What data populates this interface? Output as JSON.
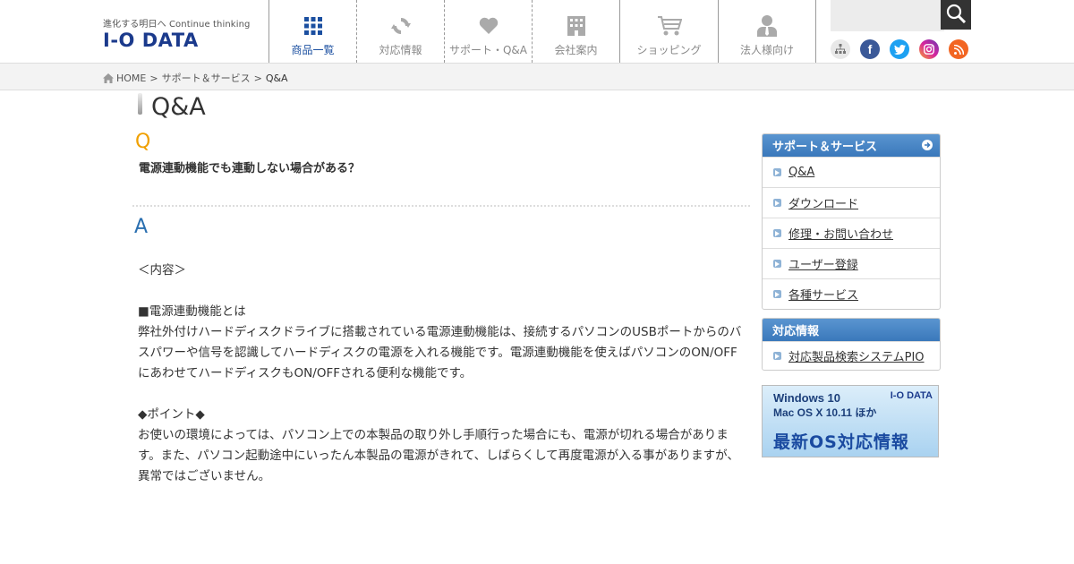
{
  "brand": {
    "tagline": "進化する明日へ Continue thinking",
    "name": "I-O DATA"
  },
  "nav": {
    "items": [
      {
        "label": "商品一覧",
        "icon": "grid-icon"
      },
      {
        "label": "対応情報",
        "icon": "refresh-icon"
      },
      {
        "label": "サポート・Q&A",
        "icon": "heart-icon"
      },
      {
        "label": "会社案内",
        "icon": "building-icon"
      },
      {
        "label": "ショッピング",
        "icon": "cart-icon"
      },
      {
        "label": "法人様向け",
        "icon": "person-icon"
      }
    ]
  },
  "search": {
    "placeholder": ""
  },
  "social": [
    "sitemap-icon",
    "facebook-icon",
    "twitter-icon",
    "instagram-icon",
    "rss-icon"
  ],
  "breadcrumb": {
    "home": "HOME",
    "sep": ">",
    "level1": "サポート＆サービス",
    "current": "Q&A"
  },
  "page": {
    "title": "Q&A",
    "q_letter": "Q",
    "question": "電源連動機能でも連動しない場合がある？",
    "a_letter": "A",
    "answer": {
      "intro": "＜内容＞",
      "section1_head": "■電源連動機能とは",
      "section1_body": "弊社外付けハードディスクドライブに搭載されている電源連動機能は、接続するパソコンのUSBポートからのバスパワーや信号を認識してハードディスクの電源を入れる機能です。電源連動機能を使えばパソコンのON/OFFにあわせてハードディスクもON/OFFされる便利な機能です。",
      "section2_head": "◆ポイント◆",
      "section2_body": "お使いの環境によっては、パソコン上での本製品の取り外し手順行った場合にも、電源が切れる場合があります。また、パソコン起動途中にいったん本製品の電源がきれて、しばらくして再度電源が入る事がありますが、異常ではございません。"
    }
  },
  "sidebar": {
    "support": {
      "title": "サポート＆サービス",
      "items": [
        "Q&A",
        "ダウンロード",
        "修理・お問い合わせ",
        "ユーザー登録",
        "各種サービス"
      ]
    },
    "compat": {
      "title": "対応情報",
      "items": [
        "対応製品検索システムPIO"
      ]
    }
  },
  "banner": {
    "line1": "Windows 10",
    "line2": "Mac OS X 10.11 ほか",
    "brand": "I-O DATA",
    "big": "最新OS対応情報"
  },
  "colors": {
    "brand_blue": "#1b3a8c",
    "q_orange": "#f0a000",
    "a_blue": "#2a6fb0",
    "sidebar_head": "#3a78bb"
  }
}
